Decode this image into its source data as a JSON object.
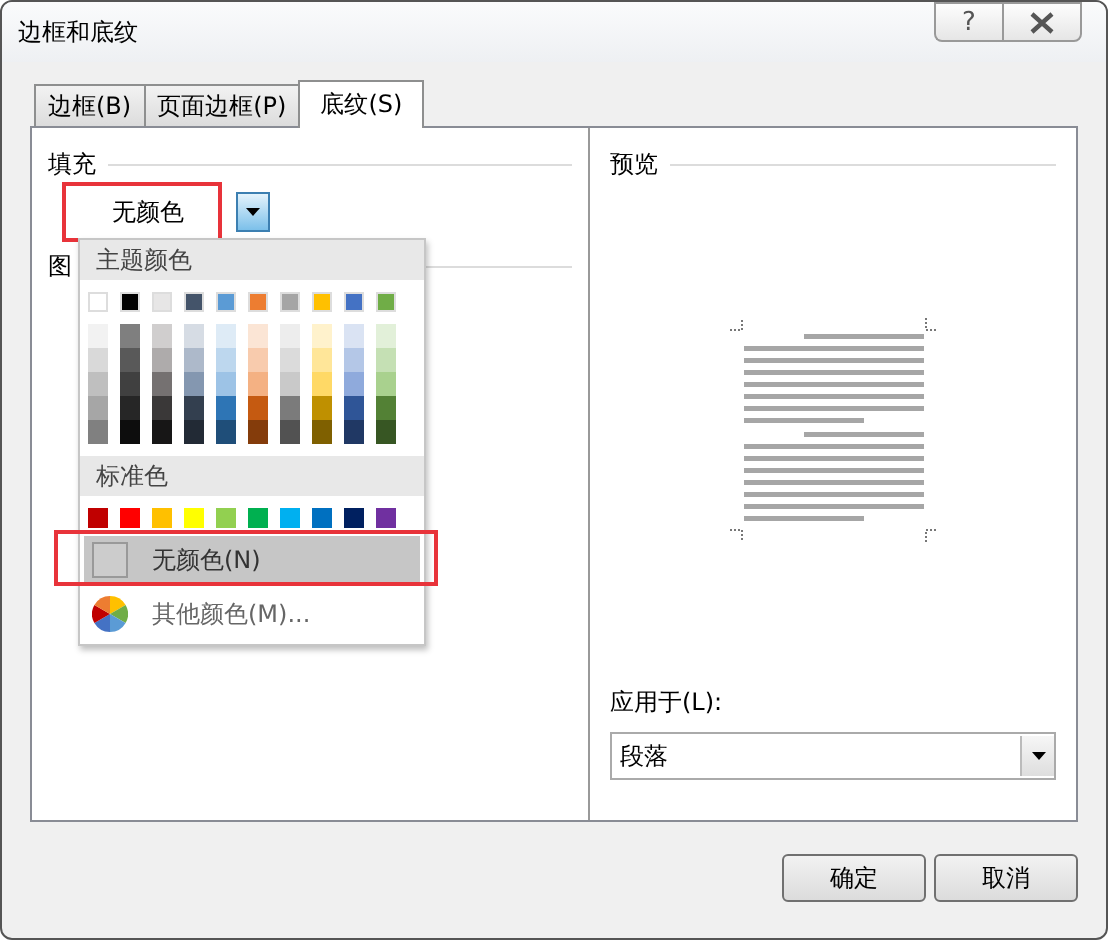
{
  "window": {
    "title": "边框和底纹",
    "help": "?"
  },
  "tabs": [
    {
      "label": "边框(B)",
      "selected": false
    },
    {
      "label": "页面边框(P)",
      "selected": false
    },
    {
      "label": "底纹(S)",
      "selected": true
    }
  ],
  "fill": {
    "label": "填充",
    "value": "无颜色",
    "expanded": true
  },
  "pattern": {
    "label": "图"
  },
  "color_menu": {
    "theme_header": "主题颜色",
    "theme_colors": [
      {
        "color": "#ffffff",
        "shades": [
          {
            "color": "#f2f2f2"
          },
          {
            "color": "#d9d9d9"
          },
          {
            "color": "#bfbfbf"
          },
          {
            "color": "#a6a6a6"
          },
          {
            "color": "#808080"
          }
        ]
      },
      {
        "color": "#000000",
        "shades": [
          {
            "color": "#7f7f7f"
          },
          {
            "color": "#595959"
          },
          {
            "color": "#404040"
          },
          {
            "color": "#262626"
          },
          {
            "color": "#0d0d0d"
          }
        ]
      },
      {
        "color": "#e7e6e6",
        "shades": [
          {
            "color": "#d0cece"
          },
          {
            "color": "#aeabab"
          },
          {
            "color": "#757171"
          },
          {
            "color": "#3a3838"
          },
          {
            "color": "#171616"
          }
        ]
      },
      {
        "color": "#44546a",
        "shades": [
          {
            "color": "#d6dce4"
          },
          {
            "color": "#adb9ca"
          },
          {
            "color": "#8497b0"
          },
          {
            "color": "#333f4f"
          },
          {
            "color": "#222a35"
          }
        ]
      },
      {
        "color": "#5b9bd5",
        "shades": [
          {
            "color": "#deebf6"
          },
          {
            "color": "#bdd7ee"
          },
          {
            "color": "#9dc3e6"
          },
          {
            "color": "#2e75b5"
          },
          {
            "color": "#1f4e79"
          }
        ]
      },
      {
        "color": "#ed7d31",
        "shades": [
          {
            "color": "#fbe5d5"
          },
          {
            "color": "#f8cbad"
          },
          {
            "color": "#f4b183"
          },
          {
            "color": "#c55a11"
          },
          {
            "color": "#843c0b"
          }
        ]
      },
      {
        "color": "#a5a5a5",
        "shades": [
          {
            "color": "#ededed"
          },
          {
            "color": "#dbdbdb"
          },
          {
            "color": "#c9c9c9"
          },
          {
            "color": "#7b7b7b"
          },
          {
            "color": "#525252"
          }
        ]
      },
      {
        "color": "#ffc000",
        "shades": [
          {
            "color": "#fff2cc"
          },
          {
            "color": "#ffe699"
          },
          {
            "color": "#ffd966"
          },
          {
            "color": "#bf9000"
          },
          {
            "color": "#7f6000"
          }
        ]
      },
      {
        "color": "#4472c4",
        "shades": [
          {
            "color": "#dae3f3"
          },
          {
            "color": "#b4c7e7"
          },
          {
            "color": "#8faadc"
          },
          {
            "color": "#2f5597"
          },
          {
            "color": "#203864"
          }
        ]
      },
      {
        "color": "#70ad47",
        "shades": [
          {
            "color": "#e2f0d9"
          },
          {
            "color": "#c5e0b4"
          },
          {
            "color": "#a9d18e"
          },
          {
            "color": "#538135"
          },
          {
            "color": "#375623"
          }
        ]
      }
    ],
    "standard_header": "标准色",
    "standard_colors": [
      {
        "color": "#c00000"
      },
      {
        "color": "#ff0000"
      },
      {
        "color": "#ffc000"
      },
      {
        "color": "#ffff00"
      },
      {
        "color": "#92d050"
      },
      {
        "color": "#00b050"
      },
      {
        "color": "#00b0f0"
      },
      {
        "color": "#0070c0"
      },
      {
        "color": "#002060"
      },
      {
        "color": "#7030a0"
      }
    ],
    "items": [
      {
        "label": "无颜色(N)",
        "kind": "swatch",
        "selected": true
      },
      {
        "label": "其他颜色(M)...",
        "kind": "wheel",
        "selected": false
      }
    ]
  },
  "preview": {
    "label": "预览"
  },
  "apply_to": {
    "label": "应用于(L):",
    "value": "段落"
  },
  "buttons": [
    "确定",
    "取消"
  ]
}
